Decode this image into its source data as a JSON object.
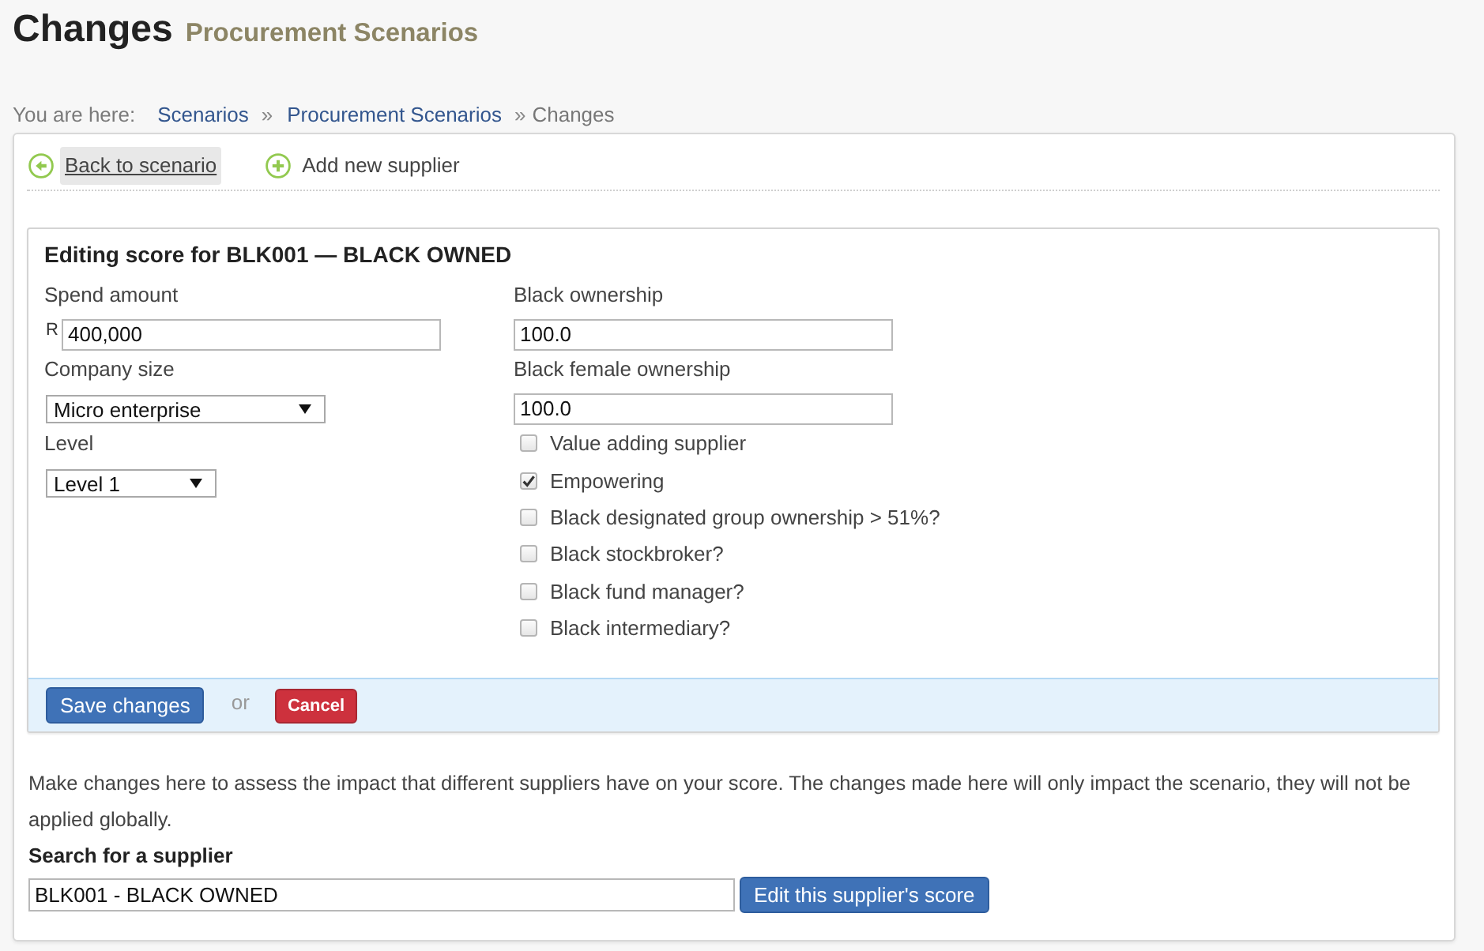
{
  "page_header": {
    "title": "Changes",
    "subtitle": "Procurement Scenarios"
  },
  "breadcrumb": {
    "label": "You are here:",
    "items": [
      {
        "text": "Scenarios",
        "kind": "link"
      },
      {
        "separator": "»",
        "text": "Procurement Scenarios",
        "kind": "link"
      },
      {
        "separator": "»",
        "text": "Changes",
        "kind": "current"
      }
    ]
  },
  "toolbar": [
    {
      "label": "Back to scenario",
      "kind": "back",
      "hovered": true
    },
    {
      "label": "Add new supplier",
      "kind": "add",
      "hovered": false
    }
  ],
  "edit_form": {
    "title": "Editing score for BLK001 — BLACK OWNED",
    "left_fields": [
      {
        "label": "Spend amount",
        "kind": "text",
        "prefix": "R",
        "value": "400,000"
      },
      {
        "label": "Company size",
        "kind": "select",
        "value": "Micro enterprise"
      },
      {
        "label": "Level",
        "kind": "select",
        "value": "Level 1"
      }
    ],
    "right_fields": [
      {
        "label": "Black ownership",
        "kind": "text",
        "value": "100.0"
      },
      {
        "label": "Black female ownership",
        "kind": "text",
        "value": "100.0"
      }
    ],
    "checkboxes": [
      {
        "label": "Value adding supplier",
        "checked": false
      },
      {
        "label": "Empowering",
        "checked": true
      },
      {
        "label": "Black designated group ownership > 51%?",
        "checked": false
      },
      {
        "label": "Black stockbroker?",
        "checked": false
      },
      {
        "label": "Black fund manager?",
        "checked": false
      },
      {
        "label": "Black intermediary?",
        "checked": false
      }
    ],
    "actions": [
      {
        "label": "Save changes",
        "kind": "primary"
      },
      {
        "label": "or",
        "kind": "text"
      },
      {
        "label": "Cancel",
        "kind": "danger"
      }
    ]
  },
  "supplier_search": {
    "intro": "Make changes here to assess the impact that different suppliers have on your score. The changes made here will only impact the scenario, they will not be applied globally.",
    "label": "Search for a supplier",
    "value": "BLK001 - BLACK OWNED",
    "button": "Edit this supplier's score"
  }
}
